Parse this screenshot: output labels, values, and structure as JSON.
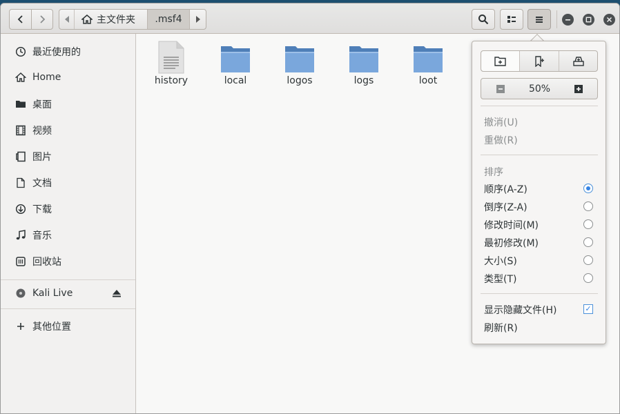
{
  "headerbar": {
    "path": {
      "home_label": "主文件夹",
      "current_label": ".msf4"
    }
  },
  "sidebar": {
    "items": [
      {
        "label": "最近使用的",
        "icon": "clock-icon"
      },
      {
        "label": "Home",
        "icon": "home-icon"
      },
      {
        "label": "桌面",
        "icon": "folder-icon"
      },
      {
        "label": "视频",
        "icon": "film-icon"
      },
      {
        "label": "图片",
        "icon": "image-icon"
      },
      {
        "label": "文档",
        "icon": "document-icon"
      },
      {
        "label": "下载",
        "icon": "download-icon"
      },
      {
        "label": "音乐",
        "icon": "music-icon"
      },
      {
        "label": "回收站",
        "icon": "trash-icon"
      }
    ],
    "drive": {
      "label": "Kali Live",
      "icon": "disc-icon"
    },
    "other_locations": {
      "label": "其他位置",
      "icon": "plus-icon"
    }
  },
  "files": [
    {
      "name": "history",
      "type": "text-file"
    },
    {
      "name": "local",
      "type": "folder"
    },
    {
      "name": "logos",
      "type": "folder"
    },
    {
      "name": "logs",
      "type": "folder"
    },
    {
      "name": "loot",
      "type": "folder"
    }
  ],
  "menu": {
    "zoom": "50%",
    "undo": "撤消(U)",
    "redo": "重做(R)",
    "sort_header": "排序",
    "sort_options": [
      {
        "label": "顺序(A-Z)",
        "selected": true
      },
      {
        "label": "倒序(Z-A)",
        "selected": false
      },
      {
        "label": "修改时间(M)",
        "selected": false
      },
      {
        "label": "最初修改(M)",
        "selected": false
      },
      {
        "label": "大小(S)",
        "selected": false
      },
      {
        "label": "类型(T)",
        "selected": false
      }
    ],
    "show_hidden": "显示隐藏文件(H)",
    "show_hidden_checked": true,
    "refresh": "刷新(R)"
  },
  "colors": {
    "accent": "#3584e4",
    "folder": "#6a9bd4"
  }
}
